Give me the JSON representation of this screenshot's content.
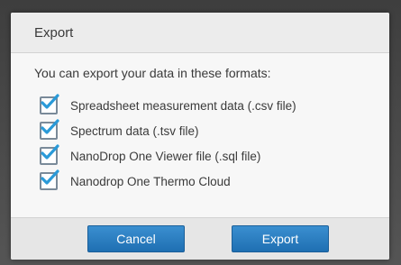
{
  "dialog": {
    "title": "Export",
    "prompt": "You can export your data in these formats:",
    "options": [
      {
        "label": "Spreadsheet measurement data (.csv file)",
        "checked": true
      },
      {
        "label": "Spectrum data (.tsv file)",
        "checked": true
      },
      {
        "label": "NanoDrop One Viewer file (.sql file)",
        "checked": true
      },
      {
        "label": "Nanodrop One Thermo Cloud",
        "checked": true
      }
    ],
    "buttons": {
      "cancel_label": "Cancel",
      "export_label": "Export"
    }
  },
  "colors": {
    "accent": "#2a7fc4",
    "check": "#2a9ad8"
  }
}
